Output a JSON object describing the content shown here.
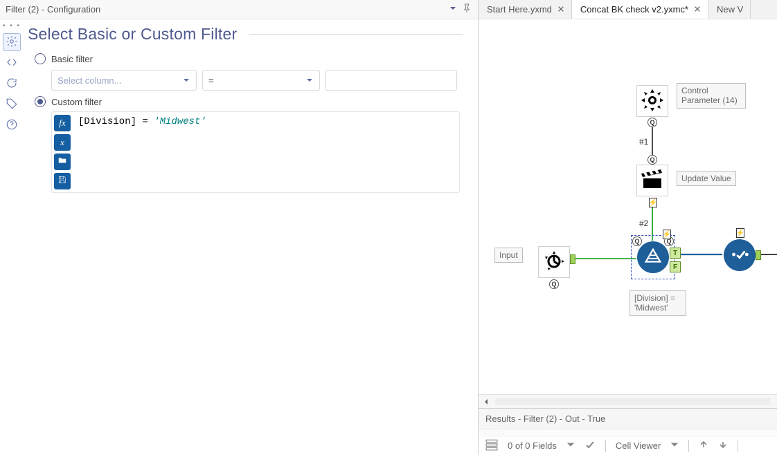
{
  "config": {
    "panel_title": "Filter (2) - Configuration",
    "heading": "Select Basic or Custom Filter",
    "basic_label": "Basic filter",
    "custom_label": "Custom filter",
    "select_column_placeholder": "Select column...",
    "operator_value": "=",
    "value_input": "",
    "expression_field": "[Division]",
    "expression_op": "=",
    "expression_literal": "'Midwest'",
    "selected_mode": "custom"
  },
  "side_tabs": {
    "active_index": 0,
    "icons": [
      "gear-icon",
      "code-icon",
      "sync-icon",
      "tag-icon",
      "help-icon"
    ]
  },
  "tabs": [
    {
      "label": "Start Here.yxmd",
      "active": false
    },
    {
      "label": "Concat BK check v2.yxmc*",
      "active": true
    },
    {
      "label": "New V",
      "active": false,
      "truncated": true
    }
  ],
  "canvas": {
    "input_label": "Input",
    "control_param_label": "Control Parameter (14)",
    "update_value_label": "Update Value",
    "conn1_label": "#1",
    "conn2_label": "#2",
    "filter_caption": "[Division] = 'Midwest'",
    "anchor_true": "T",
    "anchor_false": "F",
    "q_badge": "Q",
    "bolt_badge": "⚡"
  },
  "results": {
    "header": "Results - Filter (2) - Out - True",
    "fields_text": "0 of 0 Fields",
    "cell_viewer_text": "Cell Viewer"
  }
}
